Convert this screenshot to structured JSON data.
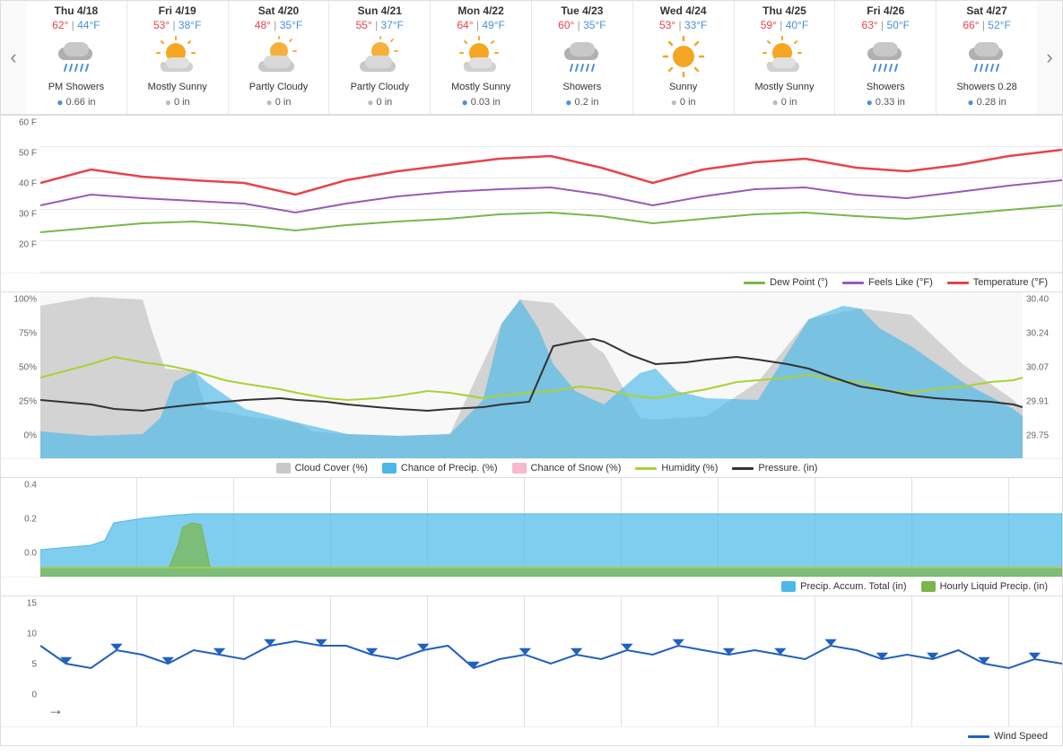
{
  "nav": {
    "prev_label": "‹",
    "next_label": "›"
  },
  "days": [
    {
      "name": "Thu 4/18",
      "high": "62°",
      "low": "44°F",
      "condition": "PM Showers",
      "precip": "0.66 in",
      "precip_type": "blue",
      "icon": "showers"
    },
    {
      "name": "Fri 4/19",
      "high": "53°",
      "low": "38°F",
      "condition": "Mostly Sunny",
      "precip": "0 in",
      "precip_type": "gray",
      "icon": "mostly-sunny"
    },
    {
      "name": "Sat 4/20",
      "high": "48°",
      "low": "35°F",
      "condition": "Partly Cloudy",
      "precip": "0 in",
      "precip_type": "gray",
      "icon": "partly-cloudy"
    },
    {
      "name": "Sun 4/21",
      "high": "55°",
      "low": "37°F",
      "condition": "Partly Cloudy",
      "precip": "0 in",
      "precip_type": "gray",
      "icon": "partly-cloudy"
    },
    {
      "name": "Mon 4/22",
      "high": "64°",
      "low": "49°F",
      "condition": "Mostly Sunny",
      "precip": "0.03 in",
      "precip_type": "blue",
      "icon": "mostly-sunny"
    },
    {
      "name": "Tue 4/23",
      "high": "60°",
      "low": "35°F",
      "condition": "Showers",
      "precip": "0.2 in",
      "precip_type": "blue",
      "icon": "showers"
    },
    {
      "name": "Wed 4/24",
      "high": "53°",
      "low": "33°F",
      "condition": "Sunny",
      "precip": "0 in",
      "precip_type": "gray",
      "icon": "sunny"
    },
    {
      "name": "Thu 4/25",
      "high": "59°",
      "low": "40°F",
      "condition": "Mostly Sunny",
      "precip": "0 in",
      "precip_type": "gray",
      "icon": "mostly-sunny"
    },
    {
      "name": "Fri 4/26",
      "high": "63°",
      "low": "50°F",
      "condition": "Showers",
      "precip": "0.33 in",
      "precip_type": "blue",
      "icon": "showers"
    },
    {
      "name": "Sat 4/27",
      "high": "66°",
      "low": "52°F",
      "condition": "Showers 0.28",
      "precip": "0.28 in",
      "precip_type": "blue",
      "icon": "showers"
    }
  ],
  "temp_chart": {
    "y_labels": [
      "60 F",
      "50 F",
      "40 F",
      "30 F",
      "20 F"
    ],
    "legend": [
      {
        "label": "Dew Point (°)",
        "color": "#7ab648",
        "type": "line"
      },
      {
        "label": "Feels Like (°F)",
        "color": "#9b59b6",
        "type": "line"
      },
      {
        "label": "Temperature (°F)",
        "color": "#e8434a",
        "type": "line"
      }
    ]
  },
  "humidity_chart": {
    "y_labels_left": [
      "100%",
      "75%",
      "50%",
      "25%",
      "0%"
    ],
    "y_labels_right": [
      "30.40",
      "30.24",
      "30.07",
      "29.91",
      "29.75"
    ],
    "legend": [
      {
        "label": "Cloud Cover (%)",
        "color": "#c8c8c8",
        "type": "area"
      },
      {
        "label": "Chance of Precip. (%)",
        "color": "#4ab9e8",
        "type": "area"
      },
      {
        "label": "Chance of Snow (%)",
        "color": "#f7b8d0",
        "type": "area"
      },
      {
        "label": "Humidity (%)",
        "color": "#aad136",
        "type": "line"
      },
      {
        "label": "Pressure. (in)",
        "color": "#333",
        "type": "line"
      }
    ]
  },
  "precip_chart": {
    "y_labels": [
      "0.4",
      "0.2",
      "0.0"
    ],
    "legend": [
      {
        "label": "Precip. Accum. Total (in)",
        "color": "#4ab9e8",
        "type": "area"
      },
      {
        "label": "Hourly Liquid Precip. (in)",
        "color": "#7ab648",
        "type": "area"
      }
    ]
  },
  "wind_chart": {
    "y_labels": [
      "15",
      "10",
      "5",
      "0"
    ],
    "legend": [
      {
        "label": "Wind Speed",
        "color": "#2060c0",
        "type": "line"
      }
    ]
  }
}
